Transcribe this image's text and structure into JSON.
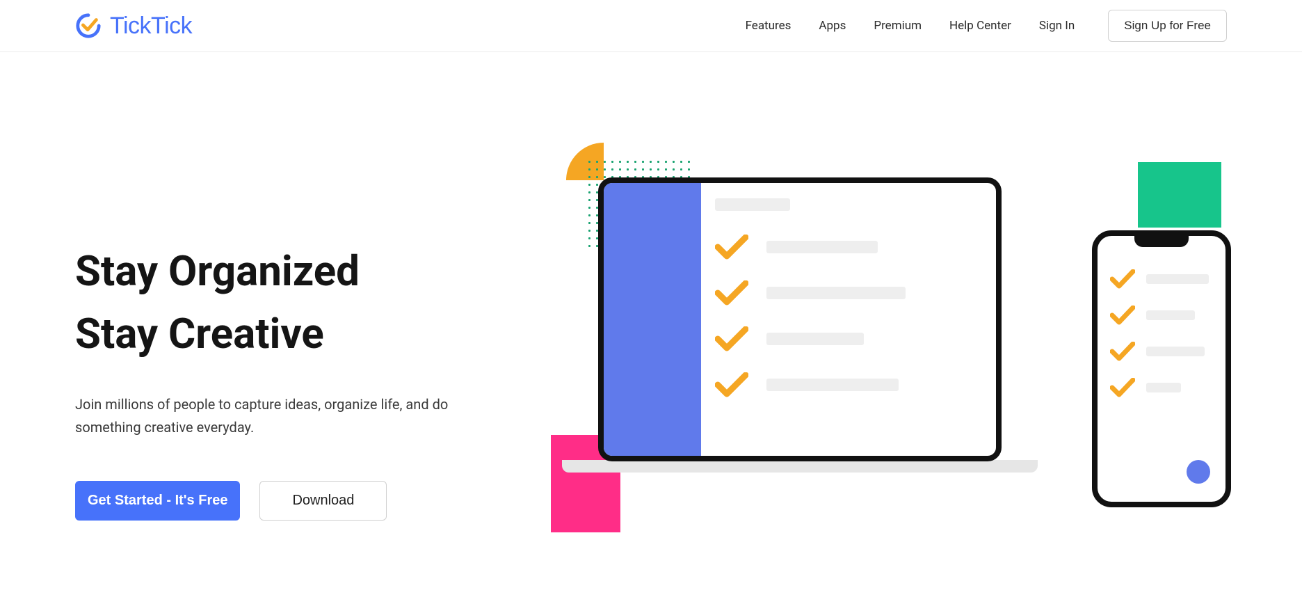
{
  "brand": {
    "name": "TickTick"
  },
  "nav": {
    "features": "Features",
    "apps": "Apps",
    "premium": "Premium",
    "help_center": "Help Center",
    "sign_in": "Sign In",
    "sign_up": "Sign Up for Free"
  },
  "hero": {
    "title": "Stay Organized\nStay Creative",
    "subtitle": "Join millions of people to capture ideas, organize life, and do something creative everyday.",
    "get_started": "Get Started - It's Free",
    "download": "Download"
  }
}
